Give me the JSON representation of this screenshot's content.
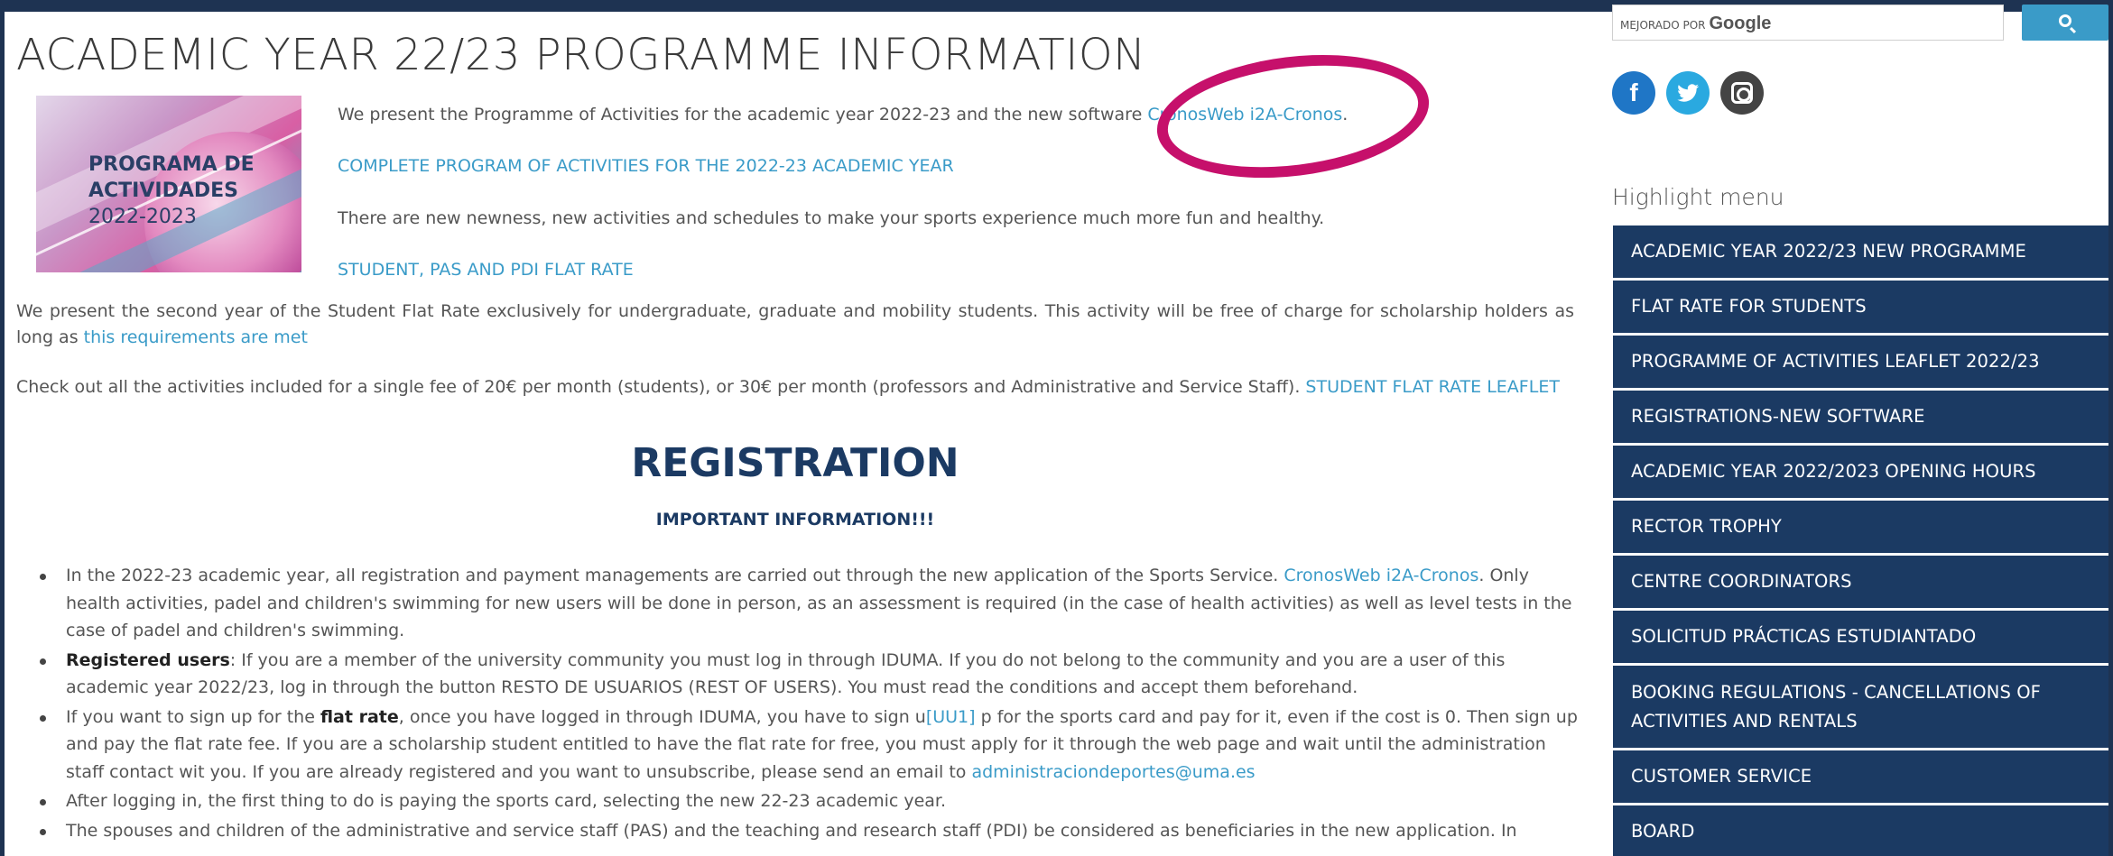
{
  "page": {
    "title": "ACADEMIC YEAR 22/23 PROGRAMME INFORMATION"
  },
  "banner": {
    "line1": "PROGRAMA DE",
    "line2": "ACTIVIDADES",
    "line3": "2022-2023"
  },
  "intro": {
    "present_text": "We present the Programme of Activities for the academic year 2022-23 and the new software ",
    "software_link": "CronosWeb i2A-Cronos",
    "present_end": ".",
    "complete_program_link": "COMPLETE PROGRAM OF ACTIVITIES FOR THE 2022-23 ACADEMIC YEAR",
    "newness_text": "There are new newness, new activities and schedules to make your sports experience much more fun and healthy.",
    "flat_rate_link": "STUDENT, PAS AND PDI FLAT RATE"
  },
  "flat_rate_para": {
    "text": "We present the second year of the Student Flat Rate exclusively for undergraduate, graduate and mobility students. This activity will be free of charge for scholarship holders as long as ",
    "link": "this requirements are met"
  },
  "fee_para": {
    "text": "Check out all the activities included for a single fee of 20€ per month (students), or 30€ per month (professors and Administrative and Service Staff). ",
    "link": "STUDENT FLAT RATE LEAFLET"
  },
  "registration": {
    "title": "REGISTRATION",
    "important": "IMPORTANT INFORMATION!!!"
  },
  "bullets": {
    "b1_a": "In the 2022-23 academic year, all registration and payment managements are carried out through the new application of the Sports Service. ",
    "b1_link": "CronosWeb i2A-Cronos",
    "b1_b": ". Only health activities, padel and children's swimming for new users will be done in person, as an assessment is required  (in the case of health activities) as well as level tests in the case of padel and children's swimming.",
    "b2_bold": "Registered users",
    "b2_text": ": If you are a member of the university community you must log in through IDUMA. If you do not belong to the community and you are a user of this academic year 2022/23, log in through the button RESTO DE USUARIOS (REST OF USERS). You must read the conditions and accept them beforehand.",
    "b3_a": "If you want to sign up for the ",
    "b3_bold": "flat rate",
    "b3_b": ", once you have logged in through IDUMA, you have to sign u",
    "b3_ref": "[UU1]",
    "b3_c": " p for the sports card and pay for it, even if the cost is 0. Then sign up and pay the flat rate fee. If you are a scholarship student entitled to have the flat rate for free, you must apply for it through the web page and wait until the administration staff contact wit you. If you are already registered and you want to unsubscribe, please send an email to ",
    "b3_email": "administraciondeportes@uma.es",
    "b4": "After logging in, the first thing to do is paying the sports card, selecting the new 22-23 academic year.",
    "b5": "The spouses and children of the administrative and service staff (PAS) and the teaching and research staff (PDI) be considered as beneficiaries in the new application. In"
  },
  "sidebar": {
    "search_powered": "MEJORADO POR",
    "search_brand": "Google",
    "social": {
      "facebook": "f",
      "twitter": "t",
      "instagram": "instagram"
    },
    "highlight_heading": "Highlight menu",
    "menu": [
      "ACADEMIC YEAR 2022/23 NEW PROGRAMME",
      "FLAT RATE FOR STUDENTS",
      "PROGRAMME OF ACTIVITIES LEAFLET 2022/23",
      "REGISTRATIONS-NEW SOFTWARE",
      "ACADEMIC YEAR 2022/2023 OPENING HOURS",
      "RECTOR TROPHY",
      "CENTRE COORDINATORS",
      "SOLICITUD PRÁCTICAS ESTUDIANTADO",
      "BOOKING REGULATIONS - CANCELLATIONS OF ACTIVITIES AND RENTALS",
      "CUSTOMER SERVICE",
      "BOARD"
    ]
  },
  "colors": {
    "frame": "#1e3352",
    "menu_bg": "#1b3a63",
    "link": "#3a9bc8",
    "annotation": "#c6106b"
  }
}
